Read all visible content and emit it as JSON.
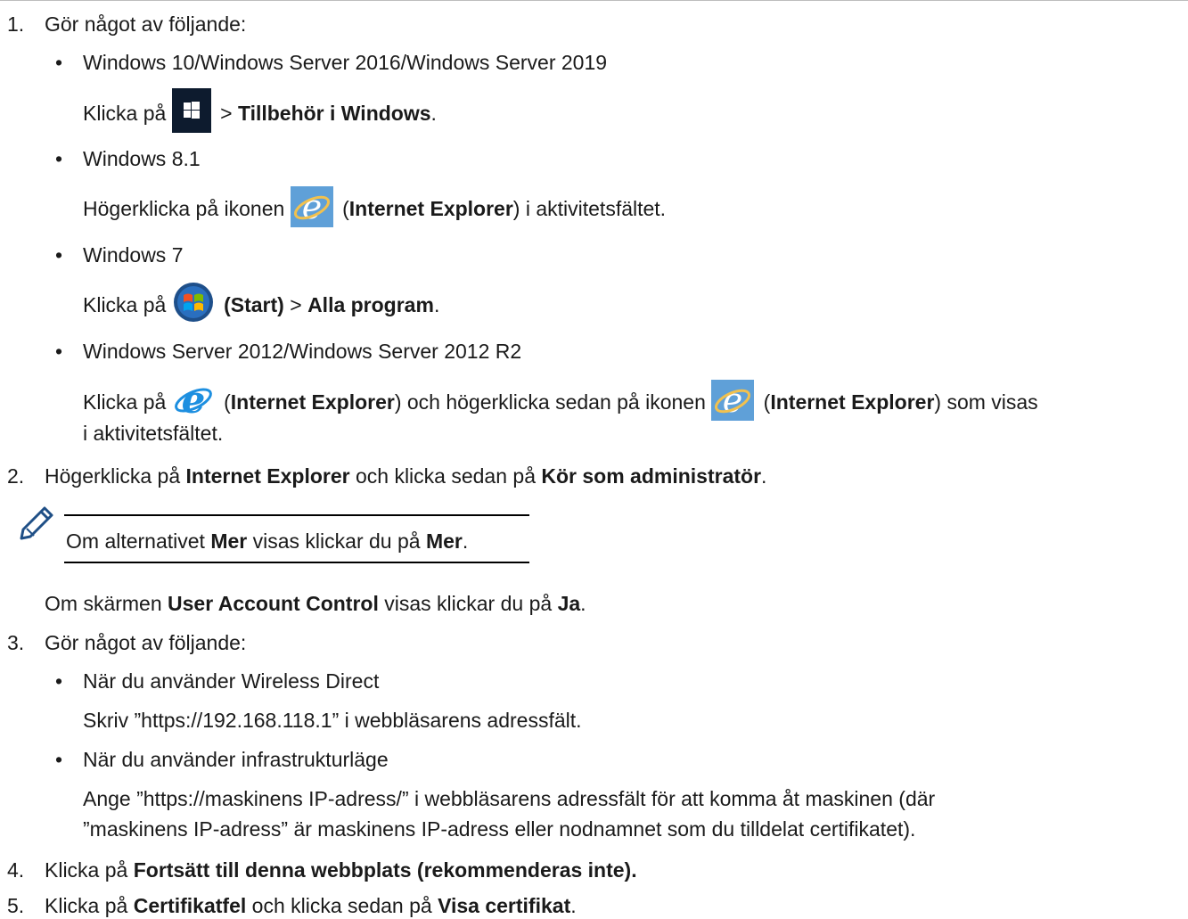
{
  "steps": {
    "s1": {
      "num": "1.",
      "text": "Gör något av följande:"
    },
    "b1": {
      "title": "Windows 10/Windows Server 2016/Windows Server 2019",
      "p1": "Klicka på",
      "p2": ">",
      "b": "Tillbehör i Windows",
      "p3": "."
    },
    "b2": {
      "title": "Windows 8.1",
      "p1": "Högerklicka på ikonen",
      "p2": "(",
      "b": "Internet Explorer",
      "p3": ") i aktivitetsfältet."
    },
    "b3": {
      "title": "Windows 7",
      "p1": "Klicka på",
      "b1": "(Start)",
      "p2": ">",
      "b2": "Alla program",
      "p3": "."
    },
    "b4": {
      "title": "Windows Server 2012/Windows Server 2012 R2",
      "p1": "Klicka på",
      "p2": "(",
      "b1": "Internet Explorer",
      "p3": ") och högerklicka sedan på ikonen",
      "p4": "(",
      "b2": "Internet Explorer",
      "p5": ") som visas",
      "p6": "i aktivitetsfältet."
    },
    "s2": {
      "num": "2.",
      "p1": "Högerklicka på",
      "b1": "Internet Explorer",
      "p2": "och klicka sedan på",
      "b2": "Kör som administratör",
      "p3": "."
    },
    "note": {
      "p1": "Om alternativet",
      "b1": "Mer",
      "p2": "visas klickar du på",
      "b2": "Mer",
      "p3": "."
    },
    "uac": {
      "p1": "Om skärmen",
      "b1": "User Account Control",
      "p2": "visas klickar du på",
      "b2": "Ja",
      "p3": "."
    },
    "s3": {
      "num": "3.",
      "text": "Gör något av följande:"
    },
    "c1": {
      "title": "När du använder Wireless Direct",
      "text": "Skriv ”https://192.168.118.1” i webbläsarens adressfält."
    },
    "c2": {
      "title": "När du använder infrastrukturläge",
      "text1": "Ange ”https://maskinens IP-adress/” i webbläsarens adressfält för att komma åt maskinen (där",
      "text2": "”maskinens IP-adress” är maskinens IP-adress eller nodnamnet som du tilldelat certifikatet)."
    },
    "s4": {
      "num": "4.",
      "p1": "Klicka på",
      "b1": "Fortsätt till denna webbplats (rekommenderas inte)."
    },
    "s5": {
      "num": "5.",
      "p1": "Klicka på",
      "b1": "Certifikatfel",
      "p2": "och klicka sedan på",
      "b2": "Visa certifikat",
      "p3": "."
    }
  },
  "icons": {
    "windows": "windows-start-icon",
    "ie_taskbar": "internet-explorer-taskbar-icon",
    "ie_plain": "internet-explorer-icon",
    "windows7": "windows7-start-orb-icon",
    "note": "pencil-note-icon"
  }
}
